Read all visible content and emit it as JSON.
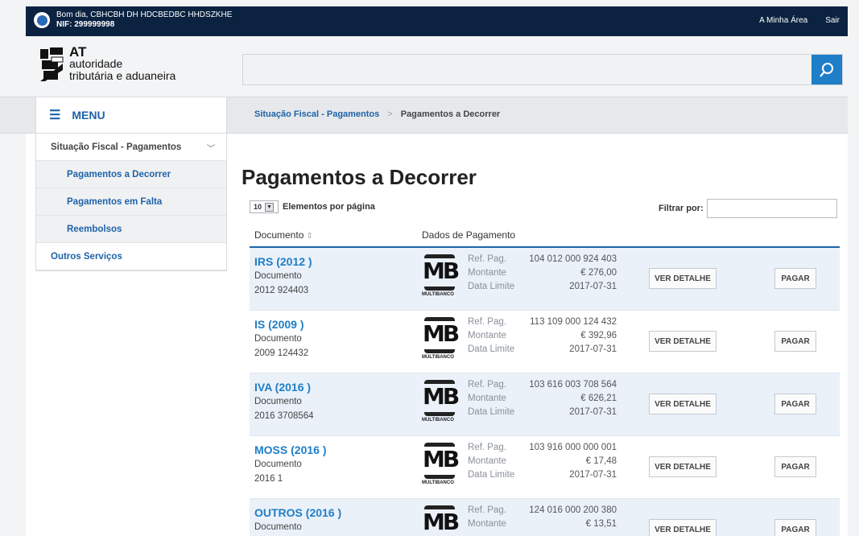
{
  "topbar": {
    "greeting": "Bom dia, CBHCBH DH HDCBEDBC HHDSZKHE",
    "nif": "NIF: 299999998",
    "my_area": "A Minha Área",
    "logout": "Sair"
  },
  "logo": {
    "line1": "AT",
    "line2": "autoridade",
    "line3": "tributária e aduaneira"
  },
  "search": {
    "placeholder": ""
  },
  "menu": {
    "label": "MENU"
  },
  "breadcrumb": {
    "parent": "Situação Fiscal - Pagamentos",
    "separator": ">",
    "current": "Pagamentos a Decorrer"
  },
  "sidebar": {
    "items": [
      {
        "label": "Situação Fiscal - Pagamentos"
      },
      {
        "label": "Pagamentos a Decorrer"
      },
      {
        "label": "Pagamentos em Falta"
      },
      {
        "label": "Reembolsos"
      },
      {
        "label": "Outros Serviços"
      }
    ]
  },
  "page": {
    "title": "Pagamentos a Decorrer",
    "per_page_value": "10",
    "per_page_label": "Elementos por página",
    "filter_label": "Filtrar por:"
  },
  "table": {
    "col_document": "Documento",
    "col_payment": "Dados de Pagamento",
    "rows": [
      {
        "name": "IRS (2012 )",
        "doc_label": "Documento",
        "doc_num": "2012 924403",
        "ref_label": "Ref. Pag.",
        "ref": "104 012 000 924 403",
        "amount_label": "Montante",
        "amount": "€ 276,00",
        "date_label": "Data Limite",
        "date": "2017-07-31",
        "detail": "VER DETALHE",
        "pay": "PAGAR"
      },
      {
        "name": "IS (2009 )",
        "doc_label": "Documento",
        "doc_num": "2009 124432",
        "ref_label": "Ref. Pag.",
        "ref": "113 109 000 124 432",
        "amount_label": "Montante",
        "amount": "€ 392,96",
        "date_label": "Data Limite",
        "date": "2017-07-31",
        "detail": "VER DETALHE",
        "pay": "PAGAR"
      },
      {
        "name": "IVA (2016 )",
        "doc_label": "Documento",
        "doc_num": "2016 3708564",
        "ref_label": "Ref. Pag.",
        "ref": "103 616 003 708 564",
        "amount_label": "Montante",
        "amount": "€ 626,21",
        "date_label": "Data Limite",
        "date": "2017-07-31",
        "detail": "VER DETALHE",
        "pay": "PAGAR"
      },
      {
        "name": "MOSS (2016 )",
        "doc_label": "Documento",
        "doc_num": "2016 1",
        "ref_label": "Ref. Pag.",
        "ref": "103 916 000 000 001",
        "amount_label": "Montante",
        "amount": "€ 17,48",
        "date_label": "Data Limite",
        "date": "2017-07-31",
        "detail": "VER DETALHE",
        "pay": "PAGAR"
      },
      {
        "name": "OUTROS (2016 )",
        "doc_label": "Documento",
        "doc_num": "",
        "ref_label": "Ref. Pag.",
        "ref": "124 016 000 200 380",
        "amount_label": "Montante",
        "amount": "€ 13,51",
        "date_label": "",
        "date": "",
        "detail": "VER DETALHE",
        "pay": "PAGAR"
      }
    ]
  },
  "mb_logo": {
    "letters": "MB",
    "word": "MULTIBANCO"
  },
  "colors": {
    "navy": "#0b2341",
    "link_blue": "#1e63a8",
    "accent_blue": "#1e7ec8",
    "row_highlight": "#eaf1f9"
  },
  "icons": {
    "search": "magnifier-icon",
    "menu": "hamburger-icon",
    "sort": "sort-icon",
    "dropdown": "chevron-down-icon"
  }
}
